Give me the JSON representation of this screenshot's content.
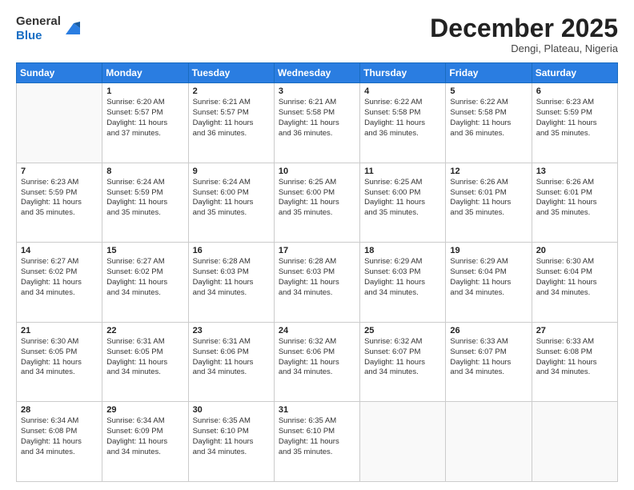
{
  "logo": {
    "general": "General",
    "blue": "Blue"
  },
  "header": {
    "month": "December 2025",
    "location": "Dengi, Plateau, Nigeria"
  },
  "days": [
    "Sunday",
    "Monday",
    "Tuesday",
    "Wednesday",
    "Thursday",
    "Friday",
    "Saturday"
  ],
  "weeks": [
    [
      {
        "day": "",
        "lines": []
      },
      {
        "day": "1",
        "lines": [
          "Sunrise: 6:20 AM",
          "Sunset: 5:57 PM",
          "Daylight: 11 hours",
          "and 37 minutes."
        ]
      },
      {
        "day": "2",
        "lines": [
          "Sunrise: 6:21 AM",
          "Sunset: 5:57 PM",
          "Daylight: 11 hours",
          "and 36 minutes."
        ]
      },
      {
        "day": "3",
        "lines": [
          "Sunrise: 6:21 AM",
          "Sunset: 5:58 PM",
          "Daylight: 11 hours",
          "and 36 minutes."
        ]
      },
      {
        "day": "4",
        "lines": [
          "Sunrise: 6:22 AM",
          "Sunset: 5:58 PM",
          "Daylight: 11 hours",
          "and 36 minutes."
        ]
      },
      {
        "day": "5",
        "lines": [
          "Sunrise: 6:22 AM",
          "Sunset: 5:58 PM",
          "Daylight: 11 hours",
          "and 36 minutes."
        ]
      },
      {
        "day": "6",
        "lines": [
          "Sunrise: 6:23 AM",
          "Sunset: 5:59 PM",
          "Daylight: 11 hours",
          "and 35 minutes."
        ]
      }
    ],
    [
      {
        "day": "7",
        "lines": [
          "Sunrise: 6:23 AM",
          "Sunset: 5:59 PM",
          "Daylight: 11 hours",
          "and 35 minutes."
        ]
      },
      {
        "day": "8",
        "lines": [
          "Sunrise: 6:24 AM",
          "Sunset: 5:59 PM",
          "Daylight: 11 hours",
          "and 35 minutes."
        ]
      },
      {
        "day": "9",
        "lines": [
          "Sunrise: 6:24 AM",
          "Sunset: 6:00 PM",
          "Daylight: 11 hours",
          "and 35 minutes."
        ]
      },
      {
        "day": "10",
        "lines": [
          "Sunrise: 6:25 AM",
          "Sunset: 6:00 PM",
          "Daylight: 11 hours",
          "and 35 minutes."
        ]
      },
      {
        "day": "11",
        "lines": [
          "Sunrise: 6:25 AM",
          "Sunset: 6:00 PM",
          "Daylight: 11 hours",
          "and 35 minutes."
        ]
      },
      {
        "day": "12",
        "lines": [
          "Sunrise: 6:26 AM",
          "Sunset: 6:01 PM",
          "Daylight: 11 hours",
          "and 35 minutes."
        ]
      },
      {
        "day": "13",
        "lines": [
          "Sunrise: 6:26 AM",
          "Sunset: 6:01 PM",
          "Daylight: 11 hours",
          "and 35 minutes."
        ]
      }
    ],
    [
      {
        "day": "14",
        "lines": [
          "Sunrise: 6:27 AM",
          "Sunset: 6:02 PM",
          "Daylight: 11 hours",
          "and 34 minutes."
        ]
      },
      {
        "day": "15",
        "lines": [
          "Sunrise: 6:27 AM",
          "Sunset: 6:02 PM",
          "Daylight: 11 hours",
          "and 34 minutes."
        ]
      },
      {
        "day": "16",
        "lines": [
          "Sunrise: 6:28 AM",
          "Sunset: 6:03 PM",
          "Daylight: 11 hours",
          "and 34 minutes."
        ]
      },
      {
        "day": "17",
        "lines": [
          "Sunrise: 6:28 AM",
          "Sunset: 6:03 PM",
          "Daylight: 11 hours",
          "and 34 minutes."
        ]
      },
      {
        "day": "18",
        "lines": [
          "Sunrise: 6:29 AM",
          "Sunset: 6:03 PM",
          "Daylight: 11 hours",
          "and 34 minutes."
        ]
      },
      {
        "day": "19",
        "lines": [
          "Sunrise: 6:29 AM",
          "Sunset: 6:04 PM",
          "Daylight: 11 hours",
          "and 34 minutes."
        ]
      },
      {
        "day": "20",
        "lines": [
          "Sunrise: 6:30 AM",
          "Sunset: 6:04 PM",
          "Daylight: 11 hours",
          "and 34 minutes."
        ]
      }
    ],
    [
      {
        "day": "21",
        "lines": [
          "Sunrise: 6:30 AM",
          "Sunset: 6:05 PM",
          "Daylight: 11 hours",
          "and 34 minutes."
        ]
      },
      {
        "day": "22",
        "lines": [
          "Sunrise: 6:31 AM",
          "Sunset: 6:05 PM",
          "Daylight: 11 hours",
          "and 34 minutes."
        ]
      },
      {
        "day": "23",
        "lines": [
          "Sunrise: 6:31 AM",
          "Sunset: 6:06 PM",
          "Daylight: 11 hours",
          "and 34 minutes."
        ]
      },
      {
        "day": "24",
        "lines": [
          "Sunrise: 6:32 AM",
          "Sunset: 6:06 PM",
          "Daylight: 11 hours",
          "and 34 minutes."
        ]
      },
      {
        "day": "25",
        "lines": [
          "Sunrise: 6:32 AM",
          "Sunset: 6:07 PM",
          "Daylight: 11 hours",
          "and 34 minutes."
        ]
      },
      {
        "day": "26",
        "lines": [
          "Sunrise: 6:33 AM",
          "Sunset: 6:07 PM",
          "Daylight: 11 hours",
          "and 34 minutes."
        ]
      },
      {
        "day": "27",
        "lines": [
          "Sunrise: 6:33 AM",
          "Sunset: 6:08 PM",
          "Daylight: 11 hours",
          "and 34 minutes."
        ]
      }
    ],
    [
      {
        "day": "28",
        "lines": [
          "Sunrise: 6:34 AM",
          "Sunset: 6:08 PM",
          "Daylight: 11 hours",
          "and 34 minutes."
        ]
      },
      {
        "day": "29",
        "lines": [
          "Sunrise: 6:34 AM",
          "Sunset: 6:09 PM",
          "Daylight: 11 hours",
          "and 34 minutes."
        ]
      },
      {
        "day": "30",
        "lines": [
          "Sunrise: 6:35 AM",
          "Sunset: 6:10 PM",
          "Daylight: 11 hours",
          "and 34 minutes."
        ]
      },
      {
        "day": "31",
        "lines": [
          "Sunrise: 6:35 AM",
          "Sunset: 6:10 PM",
          "Daylight: 11 hours",
          "and 35 minutes."
        ]
      },
      {
        "day": "",
        "lines": []
      },
      {
        "day": "",
        "lines": []
      },
      {
        "day": "",
        "lines": []
      }
    ]
  ]
}
